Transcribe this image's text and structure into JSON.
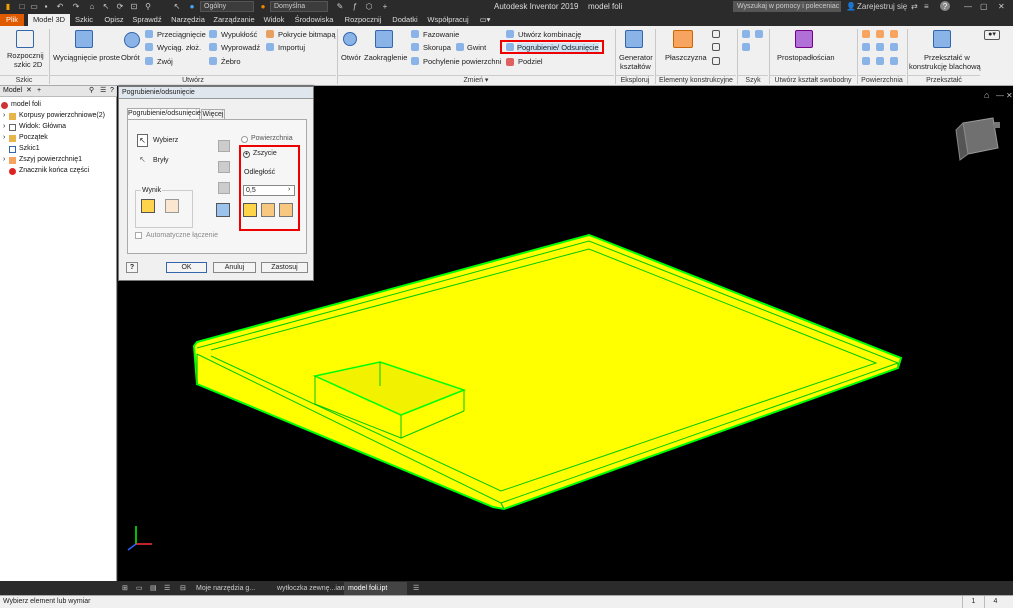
{
  "titlebar": {
    "app_title": "Autodesk Inventor 2019",
    "doc_title": "model foli",
    "material": "Ogólny",
    "appearance": "Domyślna",
    "search_placeholder": "Wyszukaj w pomocy i poleceniac",
    "sign_in": "Zarejestruj się",
    "help": "?"
  },
  "tabs": [
    "Plik",
    "Model 3D",
    "Szkic",
    "Opisz",
    "Sprawdź",
    "Narzędzia",
    "Zarządzanie",
    "Widok",
    "Środowiska",
    "Rozpocznij",
    "Dodatki",
    "Współpracuj"
  ],
  "ribbon": {
    "sketch": {
      "start_sketch": "Rozpocznij",
      "start_sketch2": "szkic 2D",
      "group": "Szkic"
    },
    "create": {
      "extrude": "Wyciągnięcie proste",
      "revolve": "Obrót",
      "sweep": "Przeciągnięcie",
      "loft": "Wyciąg. złoż.",
      "coil": "Zwój",
      "emboss": "Wypukłość",
      "derive": "Wyprowadź",
      "rib": "Żebro",
      "decal": "Pokrycie bitmapą",
      "import": "Importuj",
      "group": "Utwórz"
    },
    "modify": {
      "hole": "Otwór",
      "fillet": "Zaokrąglenie",
      "chamfer": "Fazowanie",
      "shell": "Skorupa",
      "draft": "Pochylenie powierzchni",
      "thread": "Gwint",
      "combine": "Utwórz kombinację",
      "thicken": "Pogrubienie/ Odsunięcie",
      "split": "Podziel",
      "group": "Zmień ▾"
    },
    "explore": {
      "generator": "Generator",
      "generator2": "kształtów",
      "group": "Eksploruj"
    },
    "work": {
      "plane": "Płaszczyzna",
      "group": "Elementy konstrukcyjne"
    },
    "pattern": {
      "group": "Szyk"
    },
    "freeform": {
      "box": "Prostopadłościan",
      "group": "Utwórz kształt swobodny"
    },
    "surface": {
      "group": "Powierzchnia"
    },
    "convert": {
      "sheet": "Przekształć w",
      "sheet2": "konstrukcję blachową",
      "group": "Przekształć"
    }
  },
  "browser": {
    "tab": "Model",
    "items": [
      "model foli",
      "Korpusy powierzchniowe(2)",
      "Widok: Główna",
      "Początek",
      "Szkic1",
      "Zszyj powierzchnię1",
      "Znacznik końca części"
    ]
  },
  "dialog": {
    "title": "Pogrubienie/odsunięcie",
    "tab1": "Pogrubienie/odsunięcie",
    "tab2": "Więcej",
    "select": "Wybierz",
    "solids": "Bryły",
    "output": "Wynik",
    "surface": "Powierzchnia",
    "stitch": "Zszycie",
    "distance_label": "Odległość",
    "distance": "0,5",
    "auto_blend": "Automatyczne łączenie",
    "ok": "OK",
    "cancel": "Anuluj",
    "apply": "Zastosuj",
    "help": "?"
  },
  "bottom_tabs": [
    "Moje narzędzia g...",
    "wytłoczka zewnę...iam",
    "model foli.ipt"
  ],
  "status": {
    "text": "Wybierz element lub wymiar",
    "num1": "1",
    "num2": "4"
  },
  "colors": {
    "accent": "#ff0000",
    "model_fill": "#ffff00",
    "model_edge": "#00ff00",
    "viewport": "#000000"
  }
}
